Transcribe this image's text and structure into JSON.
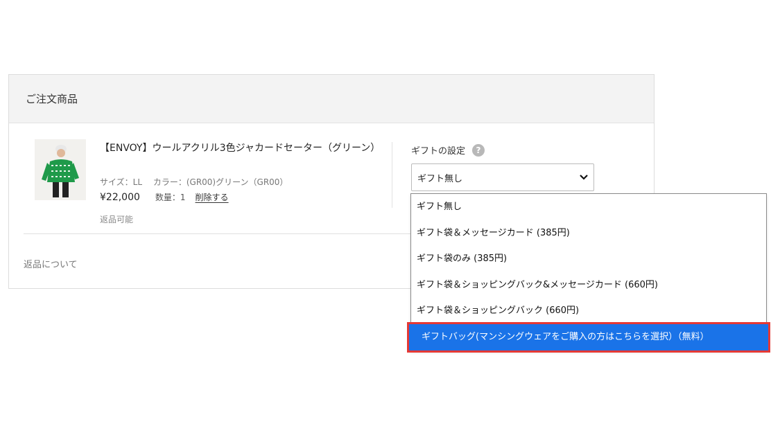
{
  "section": {
    "title": "ご注文商品"
  },
  "product": {
    "title": "【ENVOY】ウールアクリル3色ジャカードセーター（グリーン）",
    "size": "サイズ：LL",
    "color": "カラー：(GR00)グリーン（GR00）",
    "price": "¥22,000",
    "quantity": "数量：1",
    "delete_label": "削除する",
    "returnable": "返品可能",
    "image": "green-jacquard-sweater-photo"
  },
  "gift": {
    "label": "ギフトの設定",
    "help_icon": "question-circle-icon",
    "selected": "ギフト無し",
    "options": [
      "ギフト無し",
      "ギフト袋＆メッセージカード (385円)",
      "ギフト袋のみ (385円)",
      "ギフト袋＆ショッピングバック&メッセージカード (660円)",
      "ギフト袋＆ショッピングバック (660円)",
      "ギフトバッグ(マンシングウェアをご購入の方はこちらを選択）（無料）"
    ],
    "highlighted_option_index": 5
  },
  "returns_link": "返品について",
  "colors": {
    "highlight_bg": "#1a73e8",
    "highlight_outline": "#e53935",
    "header_bg": "#f3f3f3"
  }
}
